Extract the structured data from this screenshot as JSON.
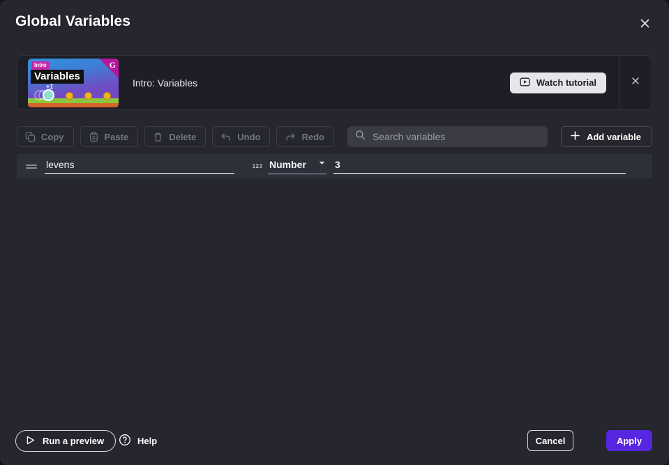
{
  "header": {
    "title": "Global Variables",
    "close_icon": "close-icon"
  },
  "tutorial_banner": {
    "label": "Intro: Variables",
    "watch_button_label": "Watch tutorial",
    "watch_button_icon": "play-box-icon",
    "close_icon": "close-icon",
    "thumbnail": {
      "badge": "Intro",
      "word": "Variables",
      "plus_one": "+1",
      "logo": "G",
      "coins": 3
    }
  },
  "toolbar": {
    "buttons": [
      {
        "label": "Copy",
        "icon": "copy-icon",
        "disabled": true
      },
      {
        "label": "Paste",
        "icon": "clipboard-icon",
        "disabled": true
      },
      {
        "label": "Delete",
        "icon": "trash-icon",
        "disabled": true
      },
      {
        "label": "Undo",
        "icon": "undo-arrow-icon",
        "disabled": true
      },
      {
        "label": "Redo",
        "icon": "redo-arrow-icon",
        "disabled": true
      }
    ],
    "search": {
      "placeholder": "Search variables",
      "value": "",
      "icon": "search-icon"
    },
    "add_variable": {
      "label": "Add variable",
      "icon": "plus-icon"
    }
  },
  "variables": {
    "columns": [
      "handle",
      "name",
      "type",
      "value"
    ],
    "rows": [
      {
        "name": "levens",
        "type_icon": "123",
        "type": "Number",
        "value": "3",
        "handle_icon": "drag-handle-icon",
        "chevron_icon": "chevron-down-icon"
      }
    ]
  },
  "footer": {
    "run_preview_label": "Run a preview",
    "run_preview_icon": "play-triangle-icon",
    "help_label": "Help",
    "help_icon": "question-circle-icon",
    "cancel_label": "Cancel",
    "apply_label": "Apply"
  },
  "colors": {
    "dialog_background": "#25262e",
    "banner_background": "#1e1f26",
    "row_background": "#2e3039",
    "search_background": "#3a3b45",
    "accent_apply": "#5626e0",
    "disabled_text": "#73757f",
    "badge_magenta": "#c52aa8",
    "coin_gold": "#f0b429",
    "grass_green": "#8cc63e"
  }
}
